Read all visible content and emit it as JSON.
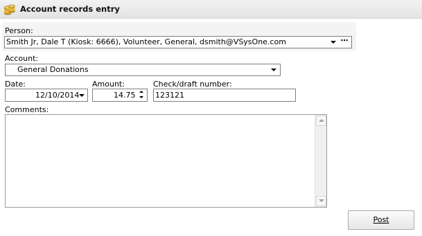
{
  "header": {
    "title": "Account records entry",
    "icon": "coins-icon"
  },
  "person": {
    "label": "Person:",
    "value": "Smith Jr, Dale T (Kiosk: 6666), Volunteer, General, dsmith@VSysOne.com",
    "browse_label": "⋯"
  },
  "account": {
    "label": "Account:",
    "value": "General Donations"
  },
  "date": {
    "label": "Date:",
    "value": "12/10/2014"
  },
  "amount": {
    "label": "Amount:",
    "value": "14.75"
  },
  "check": {
    "label": "Check/draft number:",
    "value": "123121"
  },
  "comments": {
    "label": "Comments:",
    "value": ""
  },
  "actions": {
    "post_label": "Post"
  },
  "colors": {
    "title_bar": "#e8e8e8",
    "panel_bg": "#f4f4f4",
    "border": "#7f7f7f"
  }
}
